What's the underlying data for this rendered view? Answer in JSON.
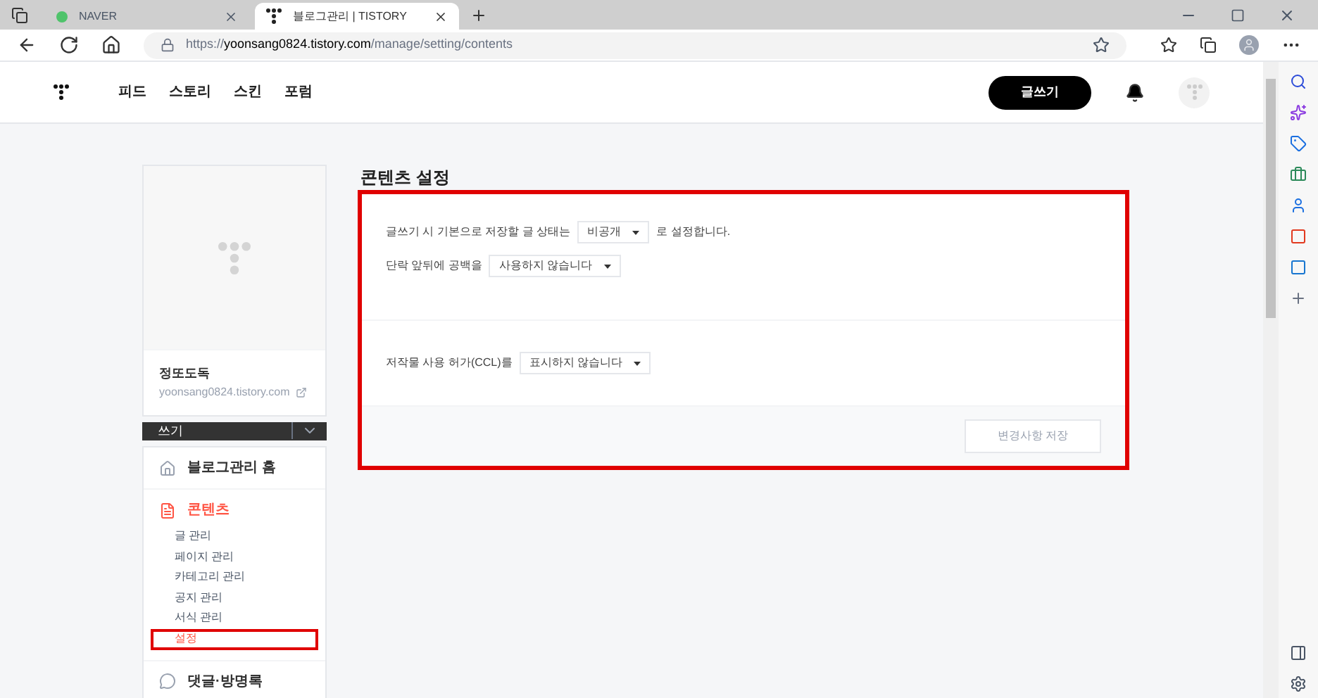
{
  "browser": {
    "tabs": [
      {
        "label": "NAVER",
        "selected": false
      },
      {
        "label": "블로그관리 | TISTORY",
        "selected": true
      }
    ],
    "url_scheme": "https://",
    "url_host": "yoonsang0824.tistory.com",
    "url_path": "/manage/setting/contents"
  },
  "header": {
    "nav": [
      "피드",
      "스토리",
      "스킨",
      "포럼"
    ],
    "write_button": "글쓰기"
  },
  "sidebar": {
    "blog_name": "정또도독",
    "blog_url": "yoonsang0824.tistory.com",
    "write_menu": "쓰기",
    "sections": [
      {
        "label": "블로그관리 홈",
        "kind": "home",
        "selected": false
      },
      {
        "label": "콘텐츠",
        "kind": "document",
        "selected": true,
        "children": [
          {
            "label": "글 관리",
            "selected": false,
            "highlighted": false
          },
          {
            "label": "페이지 관리",
            "selected": false,
            "highlighted": false
          },
          {
            "label": "카테고리 관리",
            "selected": false,
            "highlighted": false
          },
          {
            "label": "공지 관리",
            "selected": false,
            "highlighted": false
          },
          {
            "label": "서식 관리",
            "selected": false,
            "highlighted": false
          },
          {
            "label": "설정",
            "selected": true,
            "highlighted": true
          }
        ]
      },
      {
        "label": "댓글·방명록",
        "kind": "comment",
        "selected": false
      }
    ]
  },
  "main": {
    "title": "콘텐츠 설정",
    "highlighted": true,
    "groups": [
      [
        {
          "prefix": "글쓰기 시 기본으로 저장할 글 상태는",
          "select": "비공개",
          "suffix": "로 설정합니다."
        },
        {
          "prefix": "단락 앞뒤에 공백을",
          "select": "사용하지 않습니다"
        }
      ],
      [
        {
          "prefix": "저작물 사용 허가(CCL)를",
          "select": "표시하지 않습니다"
        }
      ]
    ],
    "save_button": {
      "label": "변경사항 저장",
      "disabled": true
    }
  }
}
